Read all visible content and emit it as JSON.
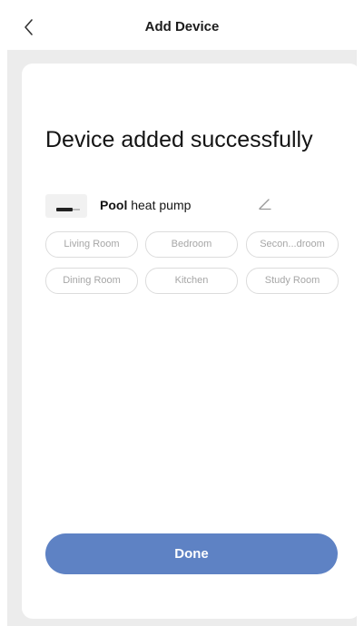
{
  "header": {
    "title": "Add Device"
  },
  "main": {
    "headline": "Device added successfully",
    "device": {
      "name_bold": "Pool",
      "name_rest": " heat pump"
    },
    "rooms": [
      "Living Room",
      "Bedroom",
      "Secon...droom",
      "Dining Room",
      "Kitchen",
      "Study Room"
    ],
    "done_label": "Done"
  },
  "colors": {
    "accent": "#5e82c4",
    "backdrop": "#ececec",
    "chip_text": "#a6a6a6"
  }
}
